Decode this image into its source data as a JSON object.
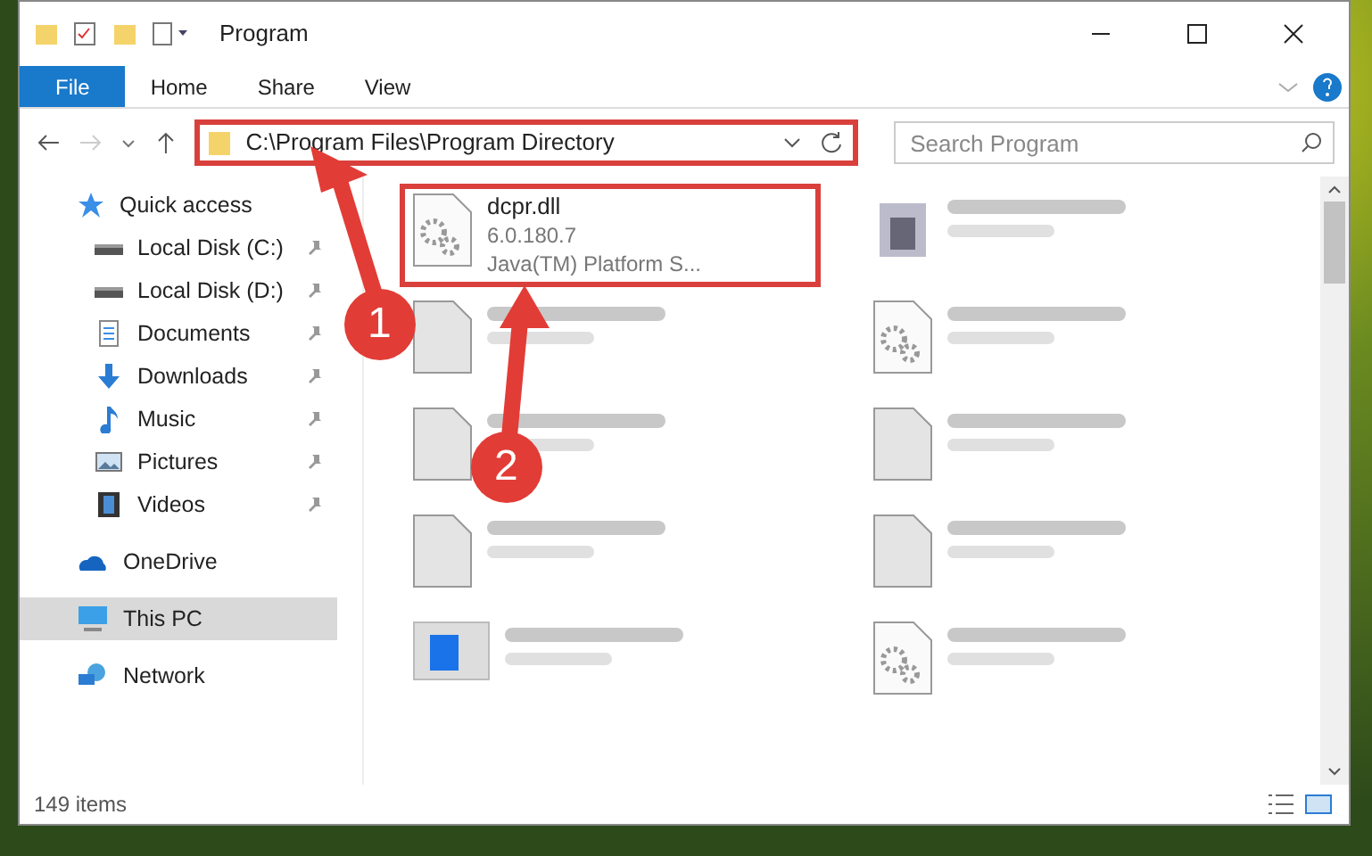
{
  "window": {
    "title": "Program"
  },
  "ribbon": {
    "tabs": [
      {
        "label": "File",
        "selected": true
      },
      {
        "label": "Home",
        "selected": false
      },
      {
        "label": "Share",
        "selected": false
      },
      {
        "label": "View",
        "selected": false
      }
    ]
  },
  "address_bar": {
    "path": "C:\\Program Files\\Program Directory",
    "highlighted": true
  },
  "search": {
    "placeholder": "Search Program"
  },
  "sidebar": {
    "items": [
      {
        "label": "Quick access",
        "kind": "star",
        "pinned": false,
        "selected": false,
        "children": [
          {
            "label": "Local Disk (C:)",
            "kind": "disk",
            "pinned": true,
            "selected": false
          },
          {
            "label": "Local Disk (D:)",
            "kind": "disk",
            "pinned": true,
            "selected": false
          },
          {
            "label": "Documents",
            "kind": "documents",
            "pinned": true,
            "selected": false
          },
          {
            "label": "Downloads",
            "kind": "downloads",
            "pinned": true,
            "selected": false
          },
          {
            "label": "Music",
            "kind": "music",
            "pinned": true,
            "selected": false
          },
          {
            "label": "Pictures",
            "kind": "pictures",
            "pinned": true,
            "selected": false
          },
          {
            "label": "Videos",
            "kind": "videos",
            "pinned": true,
            "selected": false
          }
        ]
      },
      {
        "label": "OneDrive",
        "kind": "cloud",
        "pinned": false,
        "selected": false
      },
      {
        "label": "This PC",
        "kind": "pc",
        "pinned": false,
        "selected": true
      },
      {
        "label": "Network",
        "kind": "network",
        "pinned": false,
        "selected": false
      }
    ]
  },
  "files": [
    {
      "name": "dcpr.dll",
      "lines": [
        "6.0.180.7",
        "Java(TM) Platform S..."
      ],
      "kind": "gears",
      "highlighted": true,
      "blurred": false
    },
    {
      "kind": "app",
      "highlighted": false,
      "blurred": true
    },
    {
      "kind": "blank",
      "highlighted": false,
      "blurred": true
    },
    {
      "kind": "gears",
      "highlighted": false,
      "blurred": true
    },
    {
      "kind": "blank",
      "highlighted": false,
      "blurred": true
    },
    {
      "kind": "blank",
      "highlighted": false,
      "blurred": true
    },
    {
      "kind": "blank",
      "highlighted": false,
      "blurred": true
    },
    {
      "kind": "blank",
      "highlighted": false,
      "blurred": true
    },
    {
      "kind": "window",
      "highlighted": false,
      "blurred": true
    },
    {
      "kind": "gears",
      "highlighted": false,
      "blurred": true
    }
  ],
  "status_bar": {
    "count": "149 items"
  },
  "annotations": [
    {
      "label": "1"
    },
    {
      "label": "2"
    }
  ]
}
